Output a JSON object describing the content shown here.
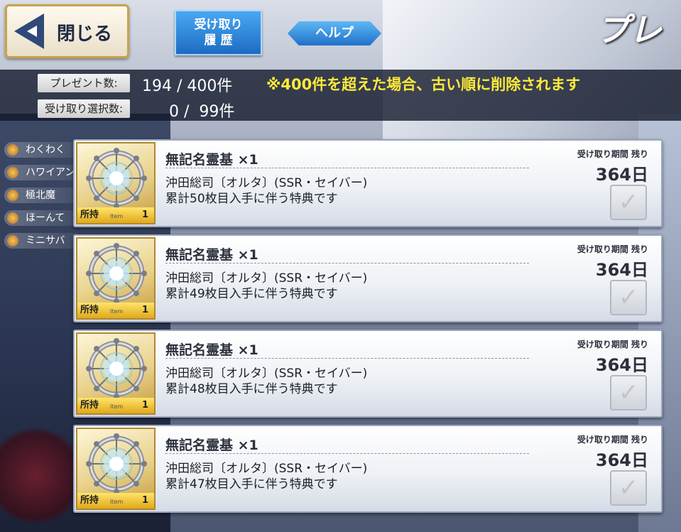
{
  "header": {
    "close_label": "閉じる",
    "history_label": "受け取り\n履 歴",
    "help_label": "ヘルプ",
    "title": "プレ"
  },
  "counts": {
    "present_label": "プレゼント数:",
    "present_value": "194 / 400件",
    "notice": "※400件を超えた場合、古い順に削除されます",
    "selected_label": "受け取り選択数:",
    "selected_value": "0 /  99件"
  },
  "background_items": [
    "わくわく",
    "ハワイアン",
    "極北魔",
    "ほーんて",
    "ミニサバ"
  ],
  "gifts": [
    {
      "name": "無記名霊基 ×1",
      "line1": "沖田総司〔オルタ〕(SSR・セイバー)",
      "line2": "累計50枚目入手に伴う特典です",
      "owned_label": "所持",
      "item_tag": "Item",
      "owned_count": "1",
      "period_label": "受け取り期間 残り",
      "days": "364日"
    },
    {
      "name": "無記名霊基 ×1",
      "line1": "沖田総司〔オルタ〕(SSR・セイバー)",
      "line2": "累計49枚目入手に伴う特典です",
      "owned_label": "所持",
      "item_tag": "Item",
      "owned_count": "1",
      "period_label": "受け取り期間 残り",
      "days": "364日"
    },
    {
      "name": "無記名霊基 ×1",
      "line1": "沖田総司〔オルタ〕(SSR・セイバー)",
      "line2": "累計48枚目入手に伴う特典です",
      "owned_label": "所持",
      "item_tag": "Item",
      "owned_count": "1",
      "period_label": "受け取り期間 残り",
      "days": "364日"
    },
    {
      "name": "無記名霊基 ×1",
      "line1": "沖田総司〔オルタ〕(SSR・セイバー)",
      "line2": "累計47枚目入手に伴う特典です",
      "owned_label": "所持",
      "item_tag": "Item",
      "owned_count": "1",
      "period_label": "受け取り期間 残り",
      "days": "364日"
    }
  ],
  "icons": {
    "close": "back-arrow-icon",
    "item": "saint-quartz-wheel-icon",
    "check": "checkmark-icon"
  }
}
